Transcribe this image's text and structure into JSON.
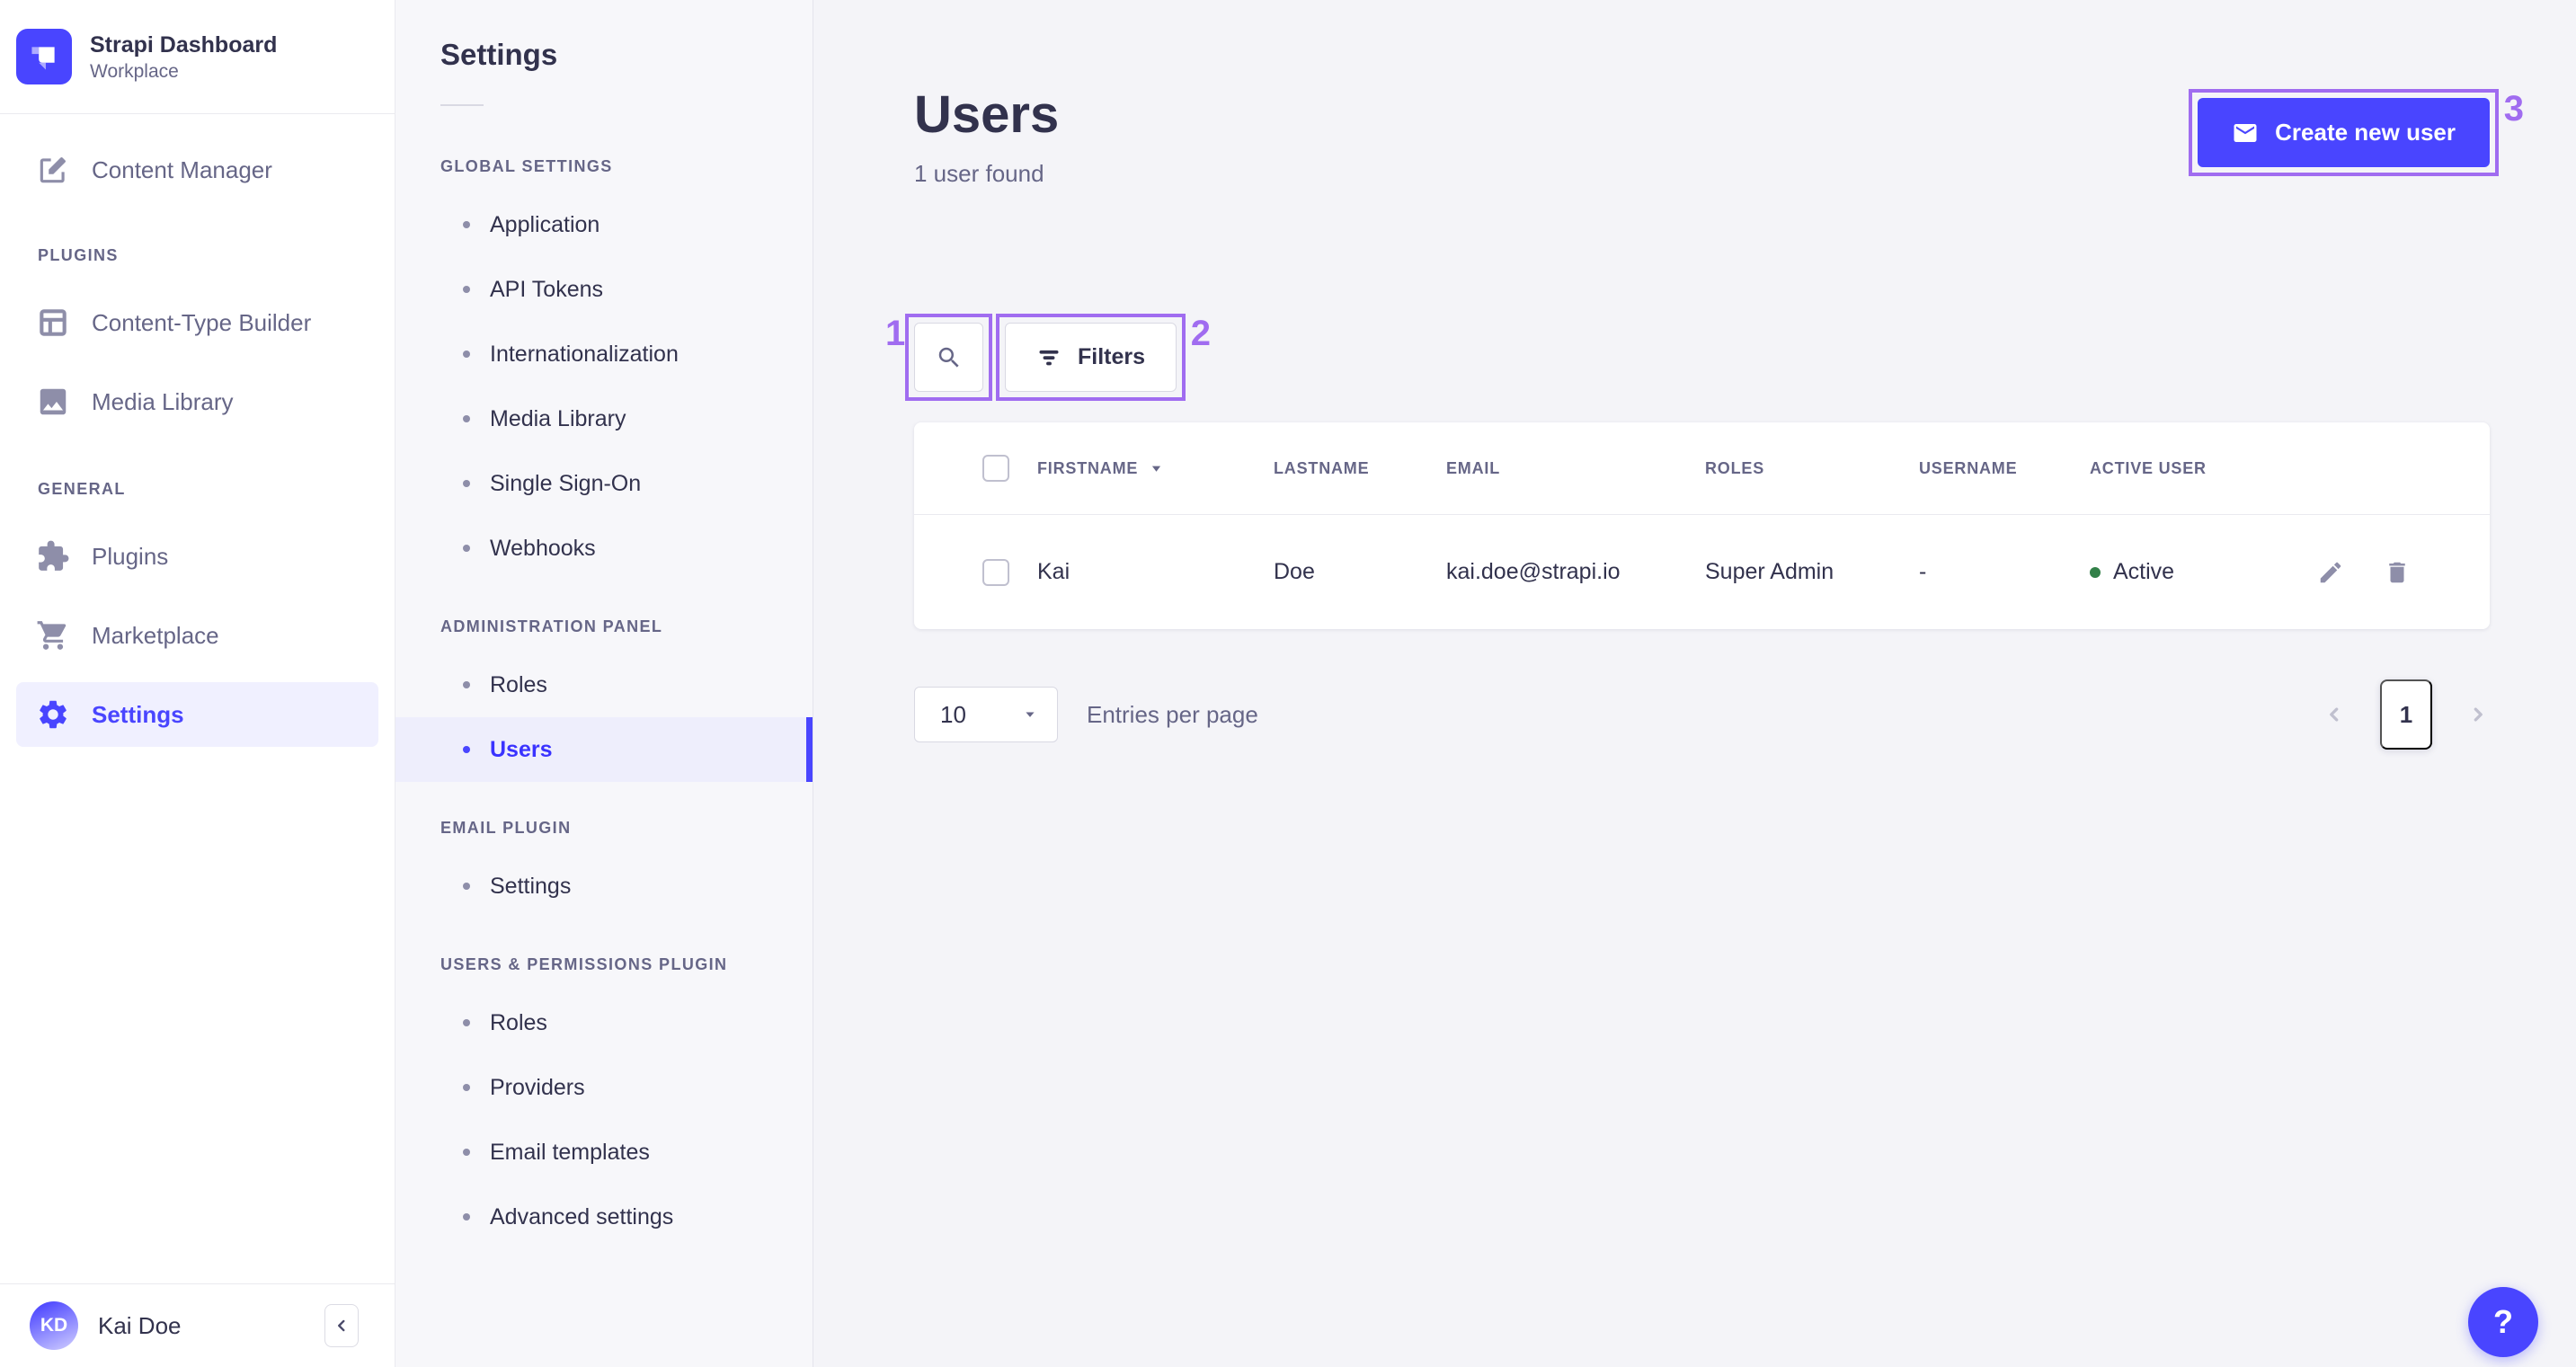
{
  "colors": {
    "accent": "#4945ff",
    "annotation": "#a06cf0",
    "success": "#328048",
    "active_bg": "#eeeefc"
  },
  "sidebar": {
    "logo_title": "Strapi Dashboard",
    "logo_subtitle": "Workplace",
    "content_manager_label": "Content Manager",
    "sections": [
      {
        "title": "PLUGINS",
        "items": [
          {
            "label": "Content-Type Builder"
          },
          {
            "label": "Media Library"
          }
        ]
      },
      {
        "title": "GENERAL",
        "items": [
          {
            "label": "Plugins"
          },
          {
            "label": "Marketplace"
          },
          {
            "label": "Settings"
          }
        ]
      }
    ],
    "user": {
      "initials": "KD",
      "name": "Kai Doe"
    }
  },
  "subnav": {
    "title": "Settings",
    "groups": [
      {
        "title": "GLOBAL SETTINGS",
        "items": [
          {
            "label": "Application"
          },
          {
            "label": "API Tokens"
          },
          {
            "label": "Internationalization"
          },
          {
            "label": "Media Library"
          },
          {
            "label": "Single Sign-On"
          },
          {
            "label": "Webhooks"
          }
        ]
      },
      {
        "title": "ADMINISTRATION PANEL",
        "items": [
          {
            "label": "Roles"
          },
          {
            "label": "Users"
          }
        ]
      },
      {
        "title": "EMAIL PLUGIN",
        "items": [
          {
            "label": "Settings"
          }
        ]
      },
      {
        "title": "USERS & PERMISSIONS PLUGIN",
        "items": [
          {
            "label": "Roles"
          },
          {
            "label": "Providers"
          },
          {
            "label": "Email templates"
          },
          {
            "label": "Advanced settings"
          }
        ]
      }
    ]
  },
  "main": {
    "title": "Users",
    "subtitle": "1 user found",
    "create_button_label": "Create new user",
    "filters_button_label": "Filters",
    "table": {
      "headers": {
        "firstname": "FIRSTNAME",
        "lastname": "LASTNAME",
        "email": "EMAIL",
        "roles": "ROLES",
        "username": "USERNAME",
        "active": "ACTIVE USER"
      },
      "rows": [
        {
          "firstname": "Kai",
          "lastname": "Doe",
          "email": "kai.doe@strapi.io",
          "roles": "Super Admin",
          "username": "-",
          "active_status": "Active"
        }
      ]
    },
    "pagination": {
      "page_size": "10",
      "entries_label": "Entries per page",
      "current_page": "1"
    }
  },
  "annotations": {
    "box1": "1",
    "box2": "2",
    "box3": "3"
  },
  "help_label": "?"
}
